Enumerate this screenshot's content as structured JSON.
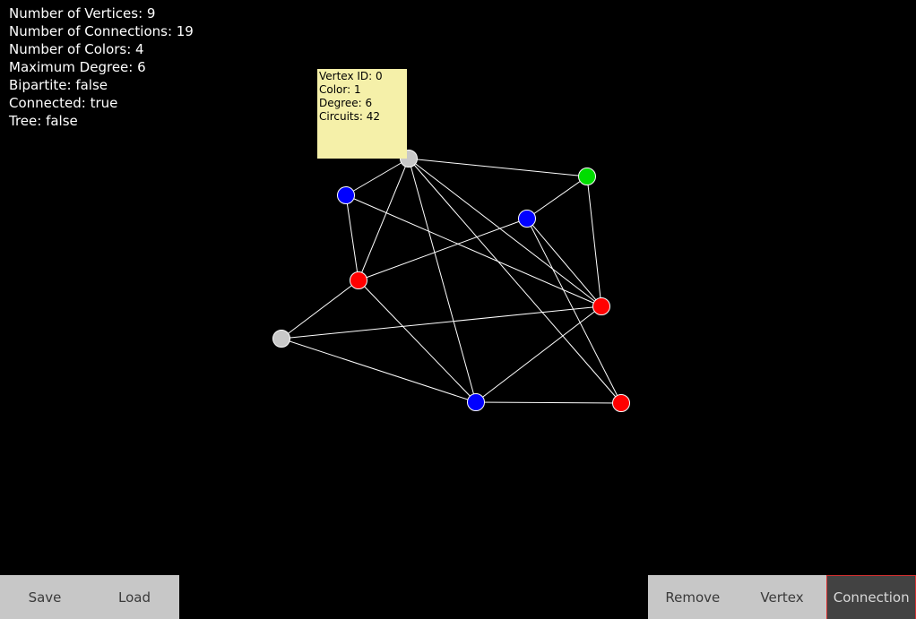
{
  "stats": [
    "Number of Vertices: 9",
    "Number of Connections: 19",
    "Number of Colors: 4",
    "Maximum Degree: 6",
    "Bipartite: false",
    "Connected: true",
    "Tree: false"
  ],
  "tooltip": {
    "lines": [
      "Vertex ID: 0",
      "Color: 1",
      "Degree: 6",
      "Circuits: 42"
    ]
  },
  "toolbar": {
    "save_label": "Save",
    "load_label": "Load",
    "remove_label": "Remove",
    "vertex_label": "Vertex",
    "connection_label": "Connection",
    "active_mode": "Connection"
  },
  "colors": {
    "background": "#000000",
    "edge": "#ffffff",
    "tooltip_bg": "#f5f0a9",
    "toolbar_bg": "#c7c7c7",
    "toolbar_active_bg": "#424242",
    "toolbar_active_border": "#d43030",
    "vertex_palette": {
      "gray": "#c8c8c8",
      "blue": "#0000ff",
      "red": "#ff0000",
      "green": "#00dd00"
    }
  },
  "graph": {
    "vertices": [
      {
        "id": 0,
        "color": "gray"
      },
      {
        "id": 1,
        "color": "blue"
      },
      {
        "id": 2,
        "color": "green"
      },
      {
        "id": 3,
        "color": "blue"
      },
      {
        "id": 4,
        "color": "red"
      },
      {
        "id": 5,
        "color": "red"
      },
      {
        "id": 6,
        "color": "gray"
      },
      {
        "id": 7,
        "color": "blue"
      },
      {
        "id": 8,
        "color": "red"
      }
    ],
    "edges": [
      [
        0,
        2
      ],
      [
        0,
        1
      ],
      [
        0,
        4
      ],
      [
        0,
        7
      ],
      [
        0,
        5
      ],
      [
        0,
        8
      ],
      [
        1,
        4
      ],
      [
        1,
        5
      ],
      [
        2,
        3
      ],
      [
        2,
        5
      ],
      [
        3,
        4
      ],
      [
        3,
        8
      ],
      [
        3,
        5
      ],
      [
        4,
        6
      ],
      [
        4,
        7
      ],
      [
        5,
        6
      ],
      [
        5,
        7
      ],
      [
        6,
        7
      ],
      [
        7,
        8
      ]
    ]
  }
}
